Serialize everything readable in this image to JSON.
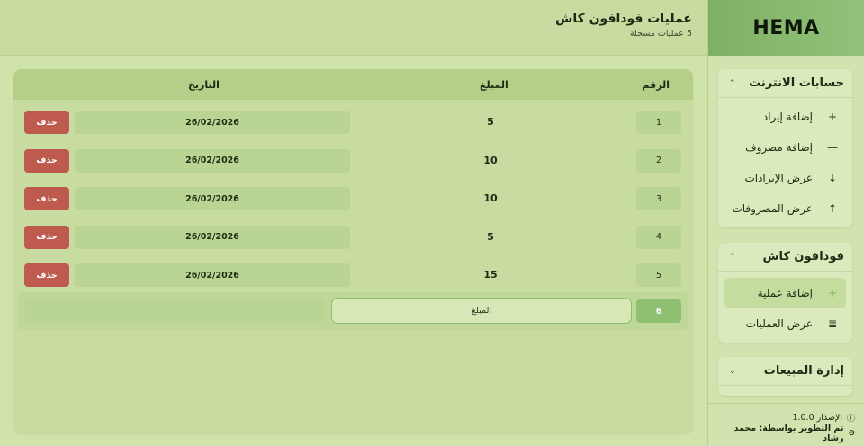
{
  "brand": "HEMA",
  "header": {
    "title": "عمليات فودافون كاش",
    "subtitle": "5 عمليات مسجلة"
  },
  "sidebar": {
    "groups": [
      {
        "title": "حسابات الانترنت",
        "chevron": "up",
        "items": [
          {
            "label": "إضافة إيراد",
            "icon": "plus-icon",
            "glyph": "+"
          },
          {
            "label": "إضافة مصروف",
            "icon": "minus-icon",
            "glyph": "—"
          },
          {
            "label": "عرض الإيرادات",
            "icon": "arrow-down-icon",
            "glyph": "↓"
          },
          {
            "label": "عرض المصروفات",
            "icon": "arrow-up-icon",
            "glyph": "↑"
          }
        ]
      },
      {
        "title": "فودافون كاش",
        "chevron": "up",
        "items": [
          {
            "label": "إضافة عملية",
            "icon": "plus-icon",
            "glyph": "+",
            "active": true
          },
          {
            "label": "عرض العمليات",
            "icon": "list-icon",
            "glyph": "≣"
          }
        ]
      },
      {
        "title": "إدارة المبيعات",
        "chevron": "down",
        "items": []
      }
    ],
    "footer": {
      "version": "الإصدار 1.0.0",
      "developer": "تم التطوير بواسطة: محمد رشاد"
    }
  },
  "table": {
    "headers": {
      "number": "الرقم",
      "amount": "المبلغ",
      "date": "التاريخ"
    },
    "rows": [
      {
        "number": "1",
        "amount": "5",
        "date": "26/02/2026",
        "delete_label": "حذف"
      },
      {
        "number": "2",
        "amount": "10",
        "date": "26/02/2026",
        "delete_label": "حذف"
      },
      {
        "number": "3",
        "amount": "10",
        "date": "26/02/2026",
        "delete_label": "حذف"
      },
      {
        "number": "4",
        "amount": "5",
        "date": "26/02/2026",
        "delete_label": "حذف"
      },
      {
        "number": "5",
        "amount": "15",
        "date": "26/02/2026",
        "delete_label": "حذف"
      }
    ],
    "new_row": {
      "number": "6",
      "amount_placeholder": "المبلغ",
      "date_value": ""
    }
  },
  "colors": {
    "accent": "#8fc072",
    "danger": "#bf5a4e",
    "brand_bg": "#7eb064"
  }
}
